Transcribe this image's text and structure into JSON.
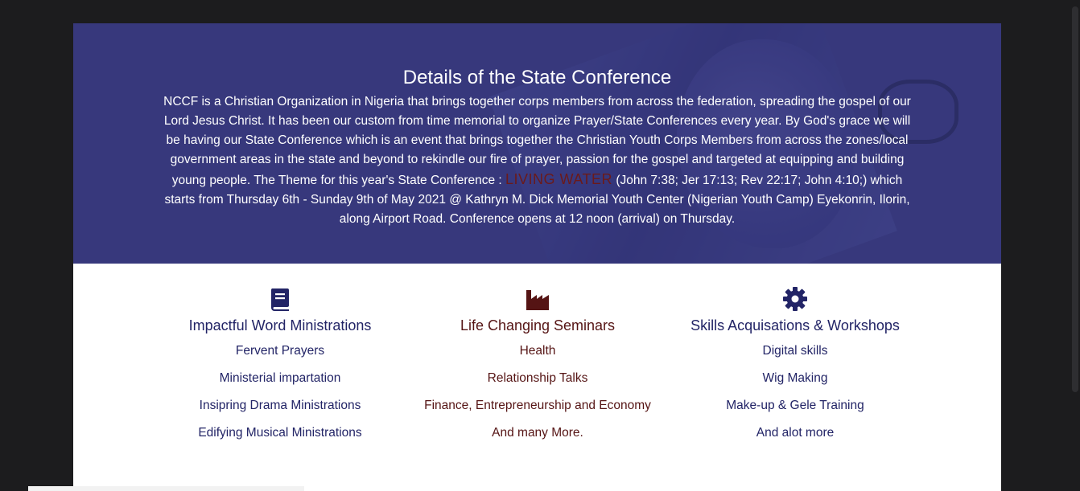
{
  "hero": {
    "title": "Details of the State Conference",
    "text_before": "NCCF is a Christian Organization in Nigeria that brings together corps members from across the federation, spreading the gospel of our Lord Jesus Christ. It has been our custom from time memorial to organize Prayer/State Conferences every year. By God's grace we will be having our State Conference which is an event that brings together the Christian Youth Corps Members from across the zones/local government areas in the state and beyond to rekindle our fire of prayer, passion for the gospel and targeted at equipping and building young people. The Theme for this year's State Conference : ",
    "theme": "LIVING WATER",
    "text_after": " (John 7:38; Jer 17:13; Rev 22:17; John 4:10;) which starts from Thursday 6th - Sunday 9th of May 2021 @ Kathryn M. Dick Memorial Youth Center (Nigerian Youth Camp) Eyekonrin, Ilorin, along Airport Road. Conference opens at 12 noon (arrival) on Thursday."
  },
  "features": [
    {
      "icon": "book-icon",
      "title": "Impactful Word Ministrations",
      "items": [
        "Fervent Prayers",
        "Ministerial impartation",
        "Insipring Drama Ministrations",
        "Edifying Musical Ministrations"
      ],
      "color": "#222466"
    },
    {
      "icon": "factory-icon",
      "title": "Life Changing Seminars",
      "items": [
        "Health",
        "Relationship Talks",
        "Finance, Entrepreneurship and Economy",
        "And many More."
      ],
      "color": "#551414"
    },
    {
      "icon": "gear-icon",
      "title": "Skills Acquisations & Workshops",
      "items": [
        "Digital skills",
        "Wig Making",
        "Make-up & Gele Training",
        "And alot more"
      ],
      "color": "#222466"
    }
  ],
  "colors": {
    "hero_bg": "#3a3b7c",
    "navy": "#222466",
    "maroon": "#551414",
    "theme_word": "#6b1a1a"
  }
}
